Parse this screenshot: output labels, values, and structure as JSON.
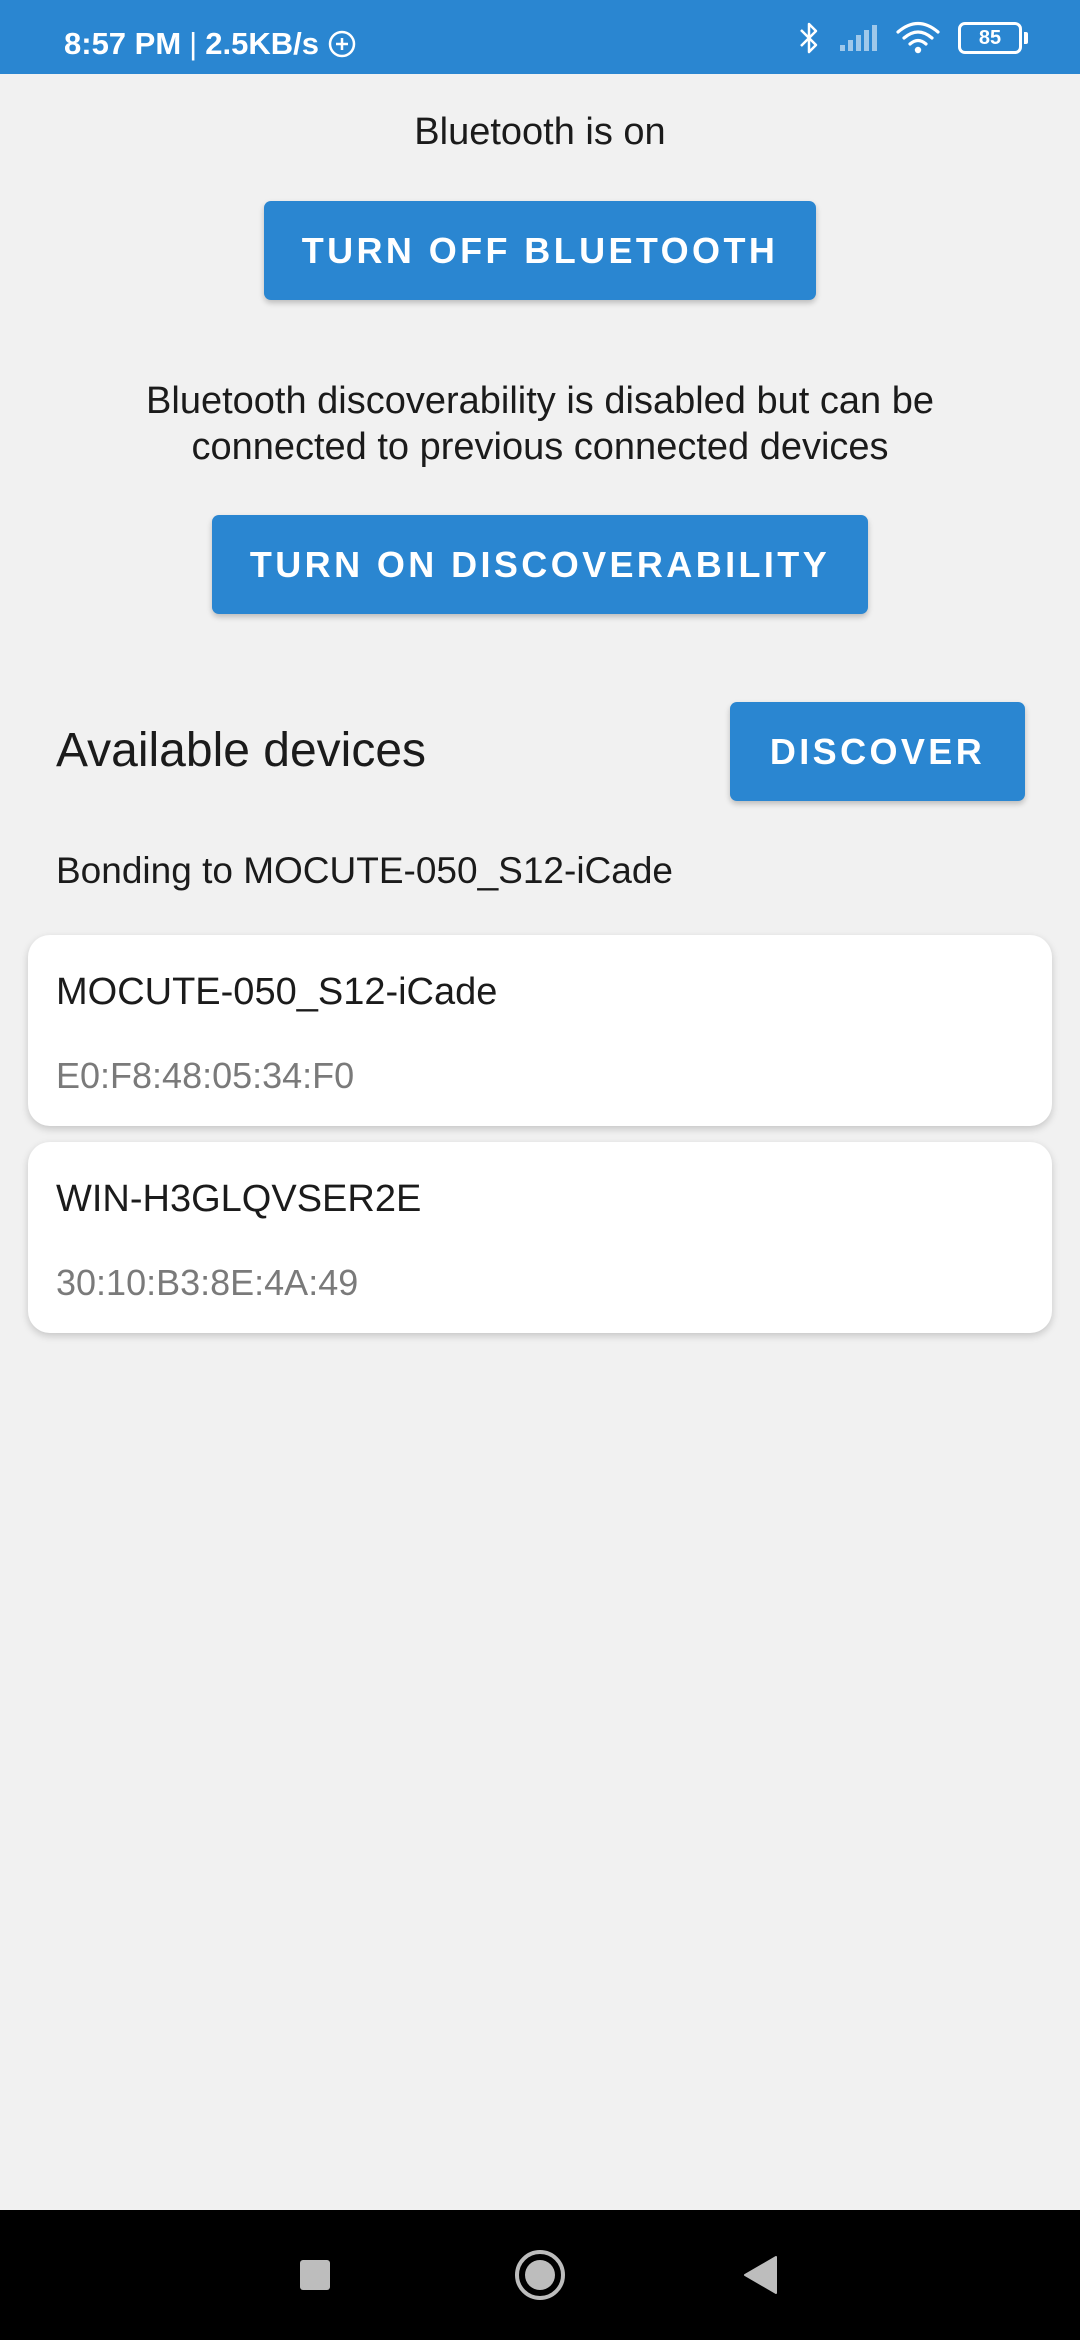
{
  "status_bar": {
    "time": "8:57 PM",
    "separator": "|",
    "speed": "2.5KB/s",
    "battery": "85",
    "icons": [
      "sync-icon",
      "bluetooth-icon",
      "signal-icon",
      "wifi-icon",
      "battery-icon"
    ]
  },
  "bluetooth": {
    "status": "Bluetooth is on",
    "toggle_label": "Turn off Bluetooth"
  },
  "discoverability": {
    "status_line1": "Bluetooth discoverability is disabled but can be",
    "status_line2": "connected to previous connected devices",
    "toggle_label": "Turn on discoverability"
  },
  "devices": {
    "title": "Available devices",
    "discover_label": "Discover",
    "bonding_status": "Bonding to MOCUTE-050_S12-iCade",
    "items": [
      {
        "name": "MOCUTE-050_S12-iCade",
        "address": "E0:F8:48:05:34:F0"
      },
      {
        "name": "WIN-H3GLQVSER2E",
        "address": "30:10:B3:8E:4A:49"
      }
    ]
  },
  "nav_bar": {
    "icons": [
      "recents-square-icon",
      "home-circle-icon",
      "back-triangle-icon"
    ]
  },
  "colors": {
    "accent": "#2a86d1",
    "background": "#f1f1f1",
    "card": "#ffffff",
    "secondary_text": "#7a7a7a"
  }
}
